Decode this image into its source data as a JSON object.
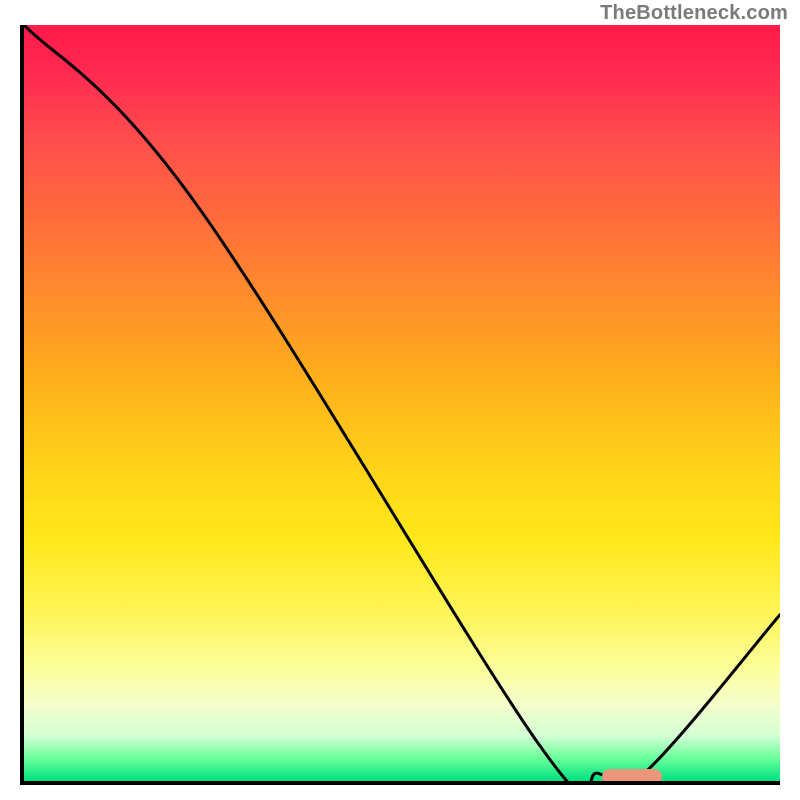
{
  "watermark": "TheBottleneck.com",
  "chart_data": {
    "type": "line",
    "title": "",
    "xlabel": "",
    "ylabel": "",
    "xlim": [
      0,
      100
    ],
    "ylim": [
      0,
      100
    ],
    "background_gradient": {
      "top_color": "#ff1a4a",
      "mid_color": "#ffd21a",
      "bottom_color": "#00e080"
    },
    "series": [
      {
        "name": "bottleneck-curve",
        "x": [
          0,
          23,
          68,
          76,
          82,
          100
        ],
        "values": [
          100,
          76,
          5,
          1,
          1,
          22
        ]
      }
    ],
    "marker": {
      "name": "optimal-range",
      "x_start": 76,
      "x_end": 84,
      "y": 1,
      "color": "#e9967a"
    }
  }
}
